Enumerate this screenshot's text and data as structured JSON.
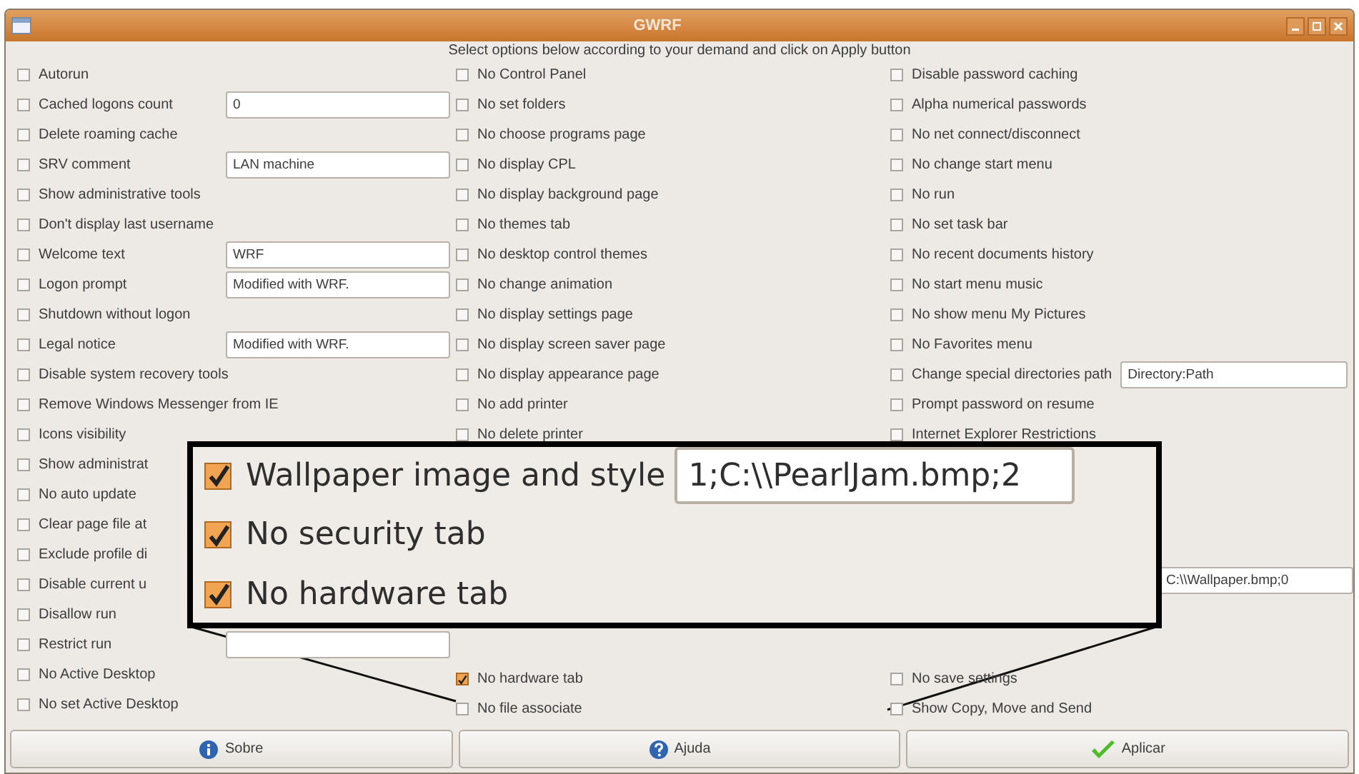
{
  "window": {
    "title": "GWRF"
  },
  "instruction": "Select options below according to your demand and click on Apply button",
  "columns": [
    {
      "top": [
        {
          "kind": "checkbox",
          "label": "Autorun",
          "checked": false
        },
        {
          "kind": "field",
          "label": "Cached logons count",
          "checked": false,
          "value": "0"
        },
        {
          "kind": "checkbox",
          "label": "Delete roaming cache",
          "checked": false
        },
        {
          "kind": "field",
          "label": "SRV comment",
          "checked": false,
          "value": "LAN machine"
        },
        {
          "kind": "checkbox",
          "label": "Show administrative tools",
          "checked": false
        },
        {
          "kind": "checkbox",
          "label": "Don't display last username",
          "checked": false
        },
        {
          "kind": "field",
          "label": "Welcome text",
          "checked": false,
          "value": "WRF"
        },
        {
          "kind": "field",
          "label": "Logon prompt",
          "checked": false,
          "value": "Modified with WRF."
        },
        {
          "kind": "checkbox",
          "label": "Shutdown without logon",
          "checked": false
        },
        {
          "kind": "field",
          "label": "Legal notice",
          "checked": false,
          "value": "Modified with WRF."
        },
        {
          "kind": "checkbox",
          "label": "Disable system recovery tools",
          "checked": false
        },
        {
          "kind": "checkbox",
          "label": "Remove Windows Messenger from IE",
          "checked": false
        },
        {
          "kind": "checkbox",
          "label": "Icons visibility",
          "checked": false
        },
        {
          "kind": "checkbox",
          "label": "Show administrat",
          "checked": false
        },
        {
          "kind": "checkbox",
          "label": "No auto update",
          "checked": false
        },
        {
          "kind": "checkbox",
          "label": "Clear page file at",
          "checked": false
        },
        {
          "kind": "checkbox",
          "label": "Exclude profile di",
          "checked": false
        },
        {
          "kind": "checkbox",
          "label": "Disable current u",
          "checked": false
        },
        {
          "kind": "checkbox",
          "label": "Disallow run",
          "checked": false
        },
        {
          "kind": "field",
          "label": "Restrict run",
          "checked": false
        },
        {
          "kind": "checkbox",
          "label": "No Active Desktop",
          "checked": false
        },
        {
          "kind": "checkbox",
          "label": "No set Active Desktop",
          "checked": false
        }
      ]
    },
    {
      "top": [
        {
          "kind": "checkbox",
          "label": "No Control Panel",
          "checked": false
        },
        {
          "kind": "checkbox",
          "label": "No set folders",
          "checked": false
        },
        {
          "kind": "checkbox",
          "label": "No choose programs page",
          "checked": false
        },
        {
          "kind": "checkbox",
          "label": "No display CPL",
          "checked": false
        },
        {
          "kind": "checkbox",
          "label": "No display background page",
          "checked": false
        },
        {
          "kind": "checkbox",
          "label": "No themes tab",
          "checked": false
        },
        {
          "kind": "checkbox",
          "label": "No desktop control themes",
          "checked": false
        },
        {
          "kind": "checkbox",
          "label": "No change animation",
          "checked": false
        },
        {
          "kind": "checkbox",
          "label": "No display settings page",
          "checked": false
        },
        {
          "kind": "checkbox",
          "label": "No display screen saver page",
          "checked": false
        },
        {
          "kind": "checkbox",
          "label": "No display appearance page",
          "checked": false
        },
        {
          "kind": "checkbox",
          "label": "No add printer",
          "checked": false
        },
        {
          "kind": "checkbox",
          "label": "No delete printer",
          "checked": false
        }
      ],
      "bottom": [
        {
          "kind": "checkbox",
          "label": "No hardware tab",
          "checked": true
        },
        {
          "kind": "checkbox",
          "label": "No file associate",
          "checked": false
        }
      ]
    },
    {
      "top": [
        {
          "kind": "checkbox",
          "label": "Disable password caching",
          "checked": false
        },
        {
          "kind": "checkbox",
          "label": "Alpha numerical passwords",
          "checked": false
        },
        {
          "kind": "checkbox",
          "label": "No net connect/disconnect",
          "checked": false
        },
        {
          "kind": "checkbox",
          "label": "No change start menu",
          "checked": false
        },
        {
          "kind": "checkbox",
          "label": "No run",
          "checked": false
        },
        {
          "kind": "checkbox",
          "label": "No set task bar",
          "checked": false
        },
        {
          "kind": "checkbox",
          "label": "No recent documents history",
          "checked": false
        },
        {
          "kind": "checkbox",
          "label": "No start menu music",
          "checked": false
        },
        {
          "kind": "checkbox",
          "label": "No show menu My Pictures",
          "checked": false
        },
        {
          "kind": "checkbox",
          "label": "No Favorites menu",
          "checked": false
        },
        {
          "kind": "field",
          "label": "Change special directories path",
          "checked": false,
          "value": "Directory:Path"
        },
        {
          "kind": "checkbox",
          "label": "Prompt password on resume",
          "checked": false
        },
        {
          "kind": "checkbox",
          "label": "Internet Explorer Restrictions",
          "checked": false
        }
      ],
      "bottom": [
        {
          "kind": "field_only",
          "value": "C:\\\\Wallpaper.bmp;0"
        },
        {
          "kind": "checkbox",
          "label": "No save settings",
          "checked": false
        },
        {
          "kind": "checkbox",
          "label": "Show Copy, Move and Send",
          "checked": false
        }
      ]
    }
  ],
  "zoom_callout": {
    "rows": [
      {
        "label": "Wallpaper image and style",
        "checked": true,
        "value": "1;C:\\\\PearlJam.bmp;2"
      },
      {
        "label": "No security tab",
        "checked": true
      },
      {
        "label": "No hardware tab",
        "checked": true
      }
    ]
  },
  "buttons": [
    {
      "label": "Sobre",
      "kind": "info"
    },
    {
      "label": "Ajuda",
      "kind": "help"
    },
    {
      "label": "Aplicar",
      "kind": "apply"
    }
  ]
}
